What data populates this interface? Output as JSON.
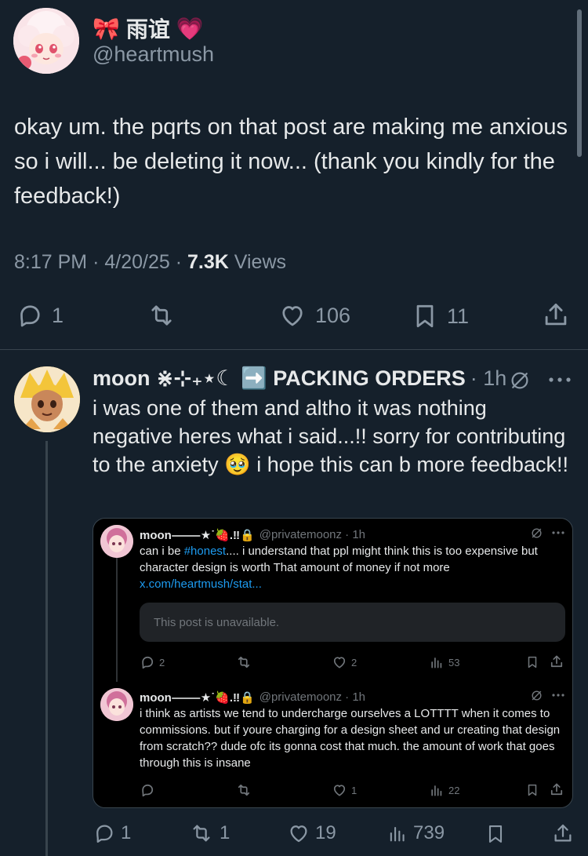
{
  "main_tweet": {
    "display_name": "雨谊",
    "name_emoji_left": "🎀",
    "name_emoji_right": "💗",
    "handle": "@heartmush",
    "text": "okay um. the pqrts on that post are making me anxious so i will... be deleting it now... (thank you kindly for the feedback!)",
    "time": "8:17 PM",
    "date": "4/20/25",
    "views_count": "7.3K",
    "views_label": "Views",
    "replies": "1",
    "reposts": "",
    "likes": "106",
    "bookmarks": "11"
  },
  "reply": {
    "display_name": "moon ⋇⊹₊⋆☾ ➡️ PACKING ORDERS",
    "time": "· 1h",
    "text_before_emoji": "i was one of them and altho it was nothing negative heres what i said...!! sorry for contributing to the anxiety ",
    "emoji": "🥹",
    "text_after_emoji": " i hope this can b more feedback!!",
    "replies": "1",
    "reposts": "1",
    "likes": "19",
    "views": "739"
  },
  "quoted": {
    "first": {
      "name": "moon⸻★˙🍓.‼︎🔒",
      "handle": "@privatemoonz · 1h",
      "text_prefix": "can i be ",
      "hashtag": "#honest",
      "text_rest": ".... i understand that ppl might think this is too expensive but character design is worth That amount of money if not more",
      "link": "x.com/heartmush/stat...",
      "unavailable": "This post is unavailable.",
      "replies": "2",
      "reposts": "",
      "likes": "2",
      "views": "53"
    },
    "second": {
      "name": "moon⸻★˙🍓.‼︎🔒",
      "handle": "@privatemoonz · 1h",
      "text": "i think as artists we tend to undercharge ourselves a LOTTTT when it comes to commissions. but if youre charging for a design sheet and ur creating that design from scratch?? dude ofc its gonna cost that much. the amount of work that goes through this is insane",
      "replies": "",
      "reposts": "",
      "likes": "1",
      "views": "22"
    }
  },
  "colors": {
    "background": "#15202b",
    "text": "#e7e9ea",
    "muted": "#8b98a5",
    "link": "#1d9bf0",
    "divider": "#38444d"
  }
}
